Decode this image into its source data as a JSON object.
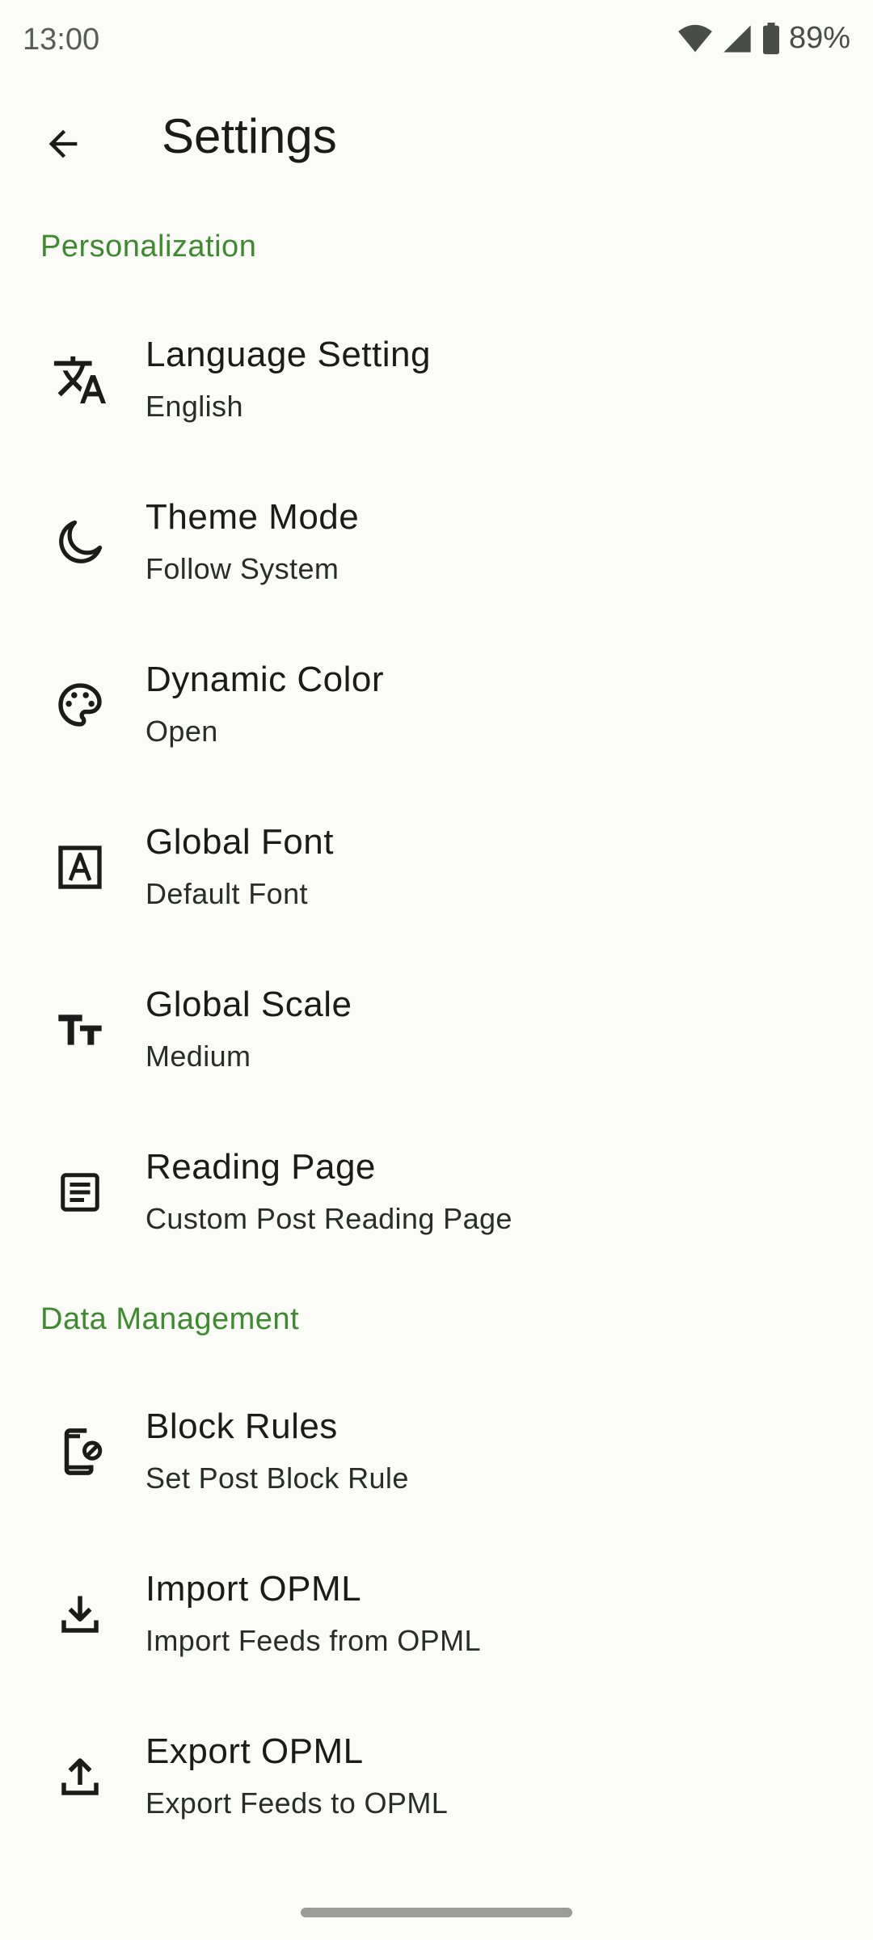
{
  "status_bar": {
    "time": "13:00",
    "battery": "89%"
  },
  "header": {
    "title": "Settings"
  },
  "sections": {
    "personalization": "Personalization",
    "data_management": "Data Management"
  },
  "items": {
    "language": {
      "title": "Language Setting",
      "subtitle": "English",
      "icon": "translate-icon"
    },
    "theme": {
      "title": "Theme Mode",
      "subtitle": "Follow System",
      "icon": "moon-icon"
    },
    "dynamic_color": {
      "title": "Dynamic Color",
      "subtitle": "Open",
      "icon": "palette-icon"
    },
    "global_font": {
      "title": "Global Font",
      "subtitle": "Default Font",
      "icon": "font-box-icon"
    },
    "global_scale": {
      "title": "Global Scale",
      "subtitle": "Medium",
      "icon": "text-size-icon"
    },
    "reading_page": {
      "title": "Reading Page",
      "subtitle": "Custom Post Reading Page",
      "icon": "article-icon"
    },
    "block_rules": {
      "title": "Block Rules",
      "subtitle": "Set Post Block Rule",
      "icon": "phone-block-icon"
    },
    "import_opml": {
      "title": "Import OPML",
      "subtitle": "Import Feeds from OPML",
      "icon": "download-icon"
    },
    "export_opml": {
      "title": "Export OPML",
      "subtitle": "Export Feeds to OPML",
      "icon": "upload-icon"
    }
  }
}
